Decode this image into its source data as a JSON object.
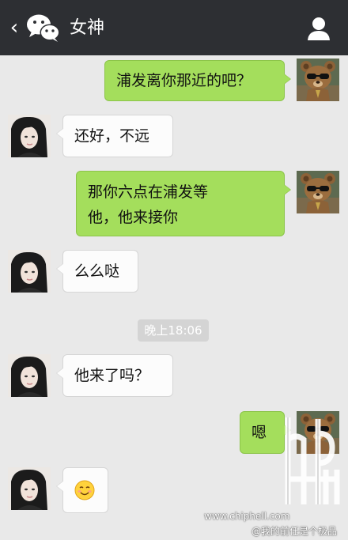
{
  "header": {
    "back_glyph": "‹",
    "title": "女神"
  },
  "messages": [
    {
      "side": "out",
      "text": "浦发离你那近的吧？"
    },
    {
      "side": "in",
      "text": "还好，不远"
    },
    {
      "side": "out",
      "line1": "那你六点在浦发等",
      "line2": "他，他来接你"
    },
    {
      "side": "in",
      "text": "么么哒"
    },
    {
      "side": "in",
      "text": "他来了吗？"
    },
    {
      "side": "out",
      "text": "嗯"
    },
    {
      "side": "in",
      "emoji": "smile-emoji"
    }
  ],
  "timestamp": "晚上18:06",
  "watermark": {
    "site": "www.chiphell.com",
    "user": "@我的前任是个极品",
    "logo_text": "chiphell"
  },
  "colors": {
    "titlebar": "#2d2f33",
    "background": "#e9e9e9",
    "bubble_out": "#a4de5c",
    "bubble_in": "#fcfcfc"
  }
}
